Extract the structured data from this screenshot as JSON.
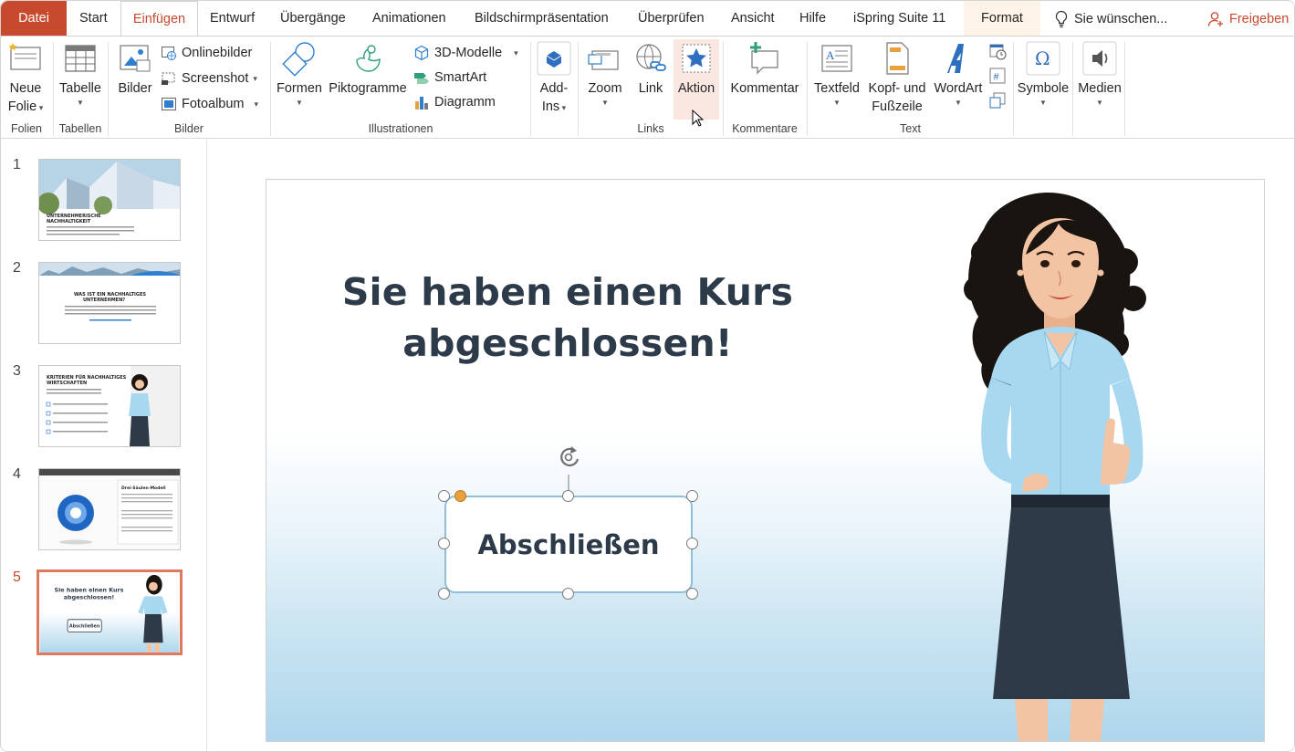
{
  "tabs": {
    "file": "Datei",
    "start": "Start",
    "insert": "Einfügen",
    "design": "Entwurf",
    "transitions": "Übergänge",
    "animations": "Animationen",
    "slideshow": "Bildschirmpräsentation",
    "review": "Überprüfen",
    "view": "Ansicht",
    "help": "Hilfe",
    "ispring": "iSpring Suite 11",
    "format": "Format"
  },
  "tell_me": "Sie wünschen...",
  "share": "Freigeben",
  "ribbon": {
    "new_slide": [
      "Neue",
      "Folie"
    ],
    "table": "Tabelle",
    "pictures": "Bilder",
    "online_pictures": "Onlinebilder",
    "screenshot": "Screenshot",
    "photo_album": "Fotoalbum",
    "shapes": "Formen",
    "icons": "Piktogramme",
    "models_3d": "3D-Modelle",
    "smartart": "SmartArt",
    "chart": "Diagramm",
    "addins": [
      "Add-",
      "Ins"
    ],
    "zoom": "Zoom",
    "link": "Link",
    "action": "Aktion",
    "comment": "Kommentar",
    "textbox": "Textfeld",
    "header_footer": [
      "Kopf- und",
      "Fußzeile"
    ],
    "wordart": "WordArt",
    "symbols": "Symbole",
    "media": "Medien",
    "groups": {
      "slides": "Folien",
      "tables": "Tabellen",
      "images": "Bilder",
      "illustrations": "Illustrationen",
      "links": "Links",
      "comments": "Kommentare",
      "text": "Text"
    }
  },
  "thumbnails": [
    {
      "num": "1",
      "title": "UNTERNEHMERISCHE NACHHALTIGKEIT"
    },
    {
      "num": "2",
      "title": "WAS IST EIN NACHHALTIGES UNTERNEHMEN?"
    },
    {
      "num": "3",
      "title": "KRITERIEN FÜR NACHHALTIGES WIRTSCHAFTEN"
    },
    {
      "num": "4",
      "title": "Drei-Säulen-Modell"
    },
    {
      "num": "5",
      "title": "Sie haben einen Kurs abgeschlossen!",
      "button": "Abschließen"
    }
  ],
  "slide": {
    "title_line1": "Sie haben einen Kurs",
    "title_line2": "abgeschlossen!",
    "button_label": "Abschließen"
  },
  "colors": {
    "accent": "#c7492e",
    "title_text": "#2d3a4a",
    "selection_border": "#8fbfd8",
    "blouse": "#a8d8ef",
    "skirt": "#2f3a49",
    "hair": "#1a1410"
  }
}
